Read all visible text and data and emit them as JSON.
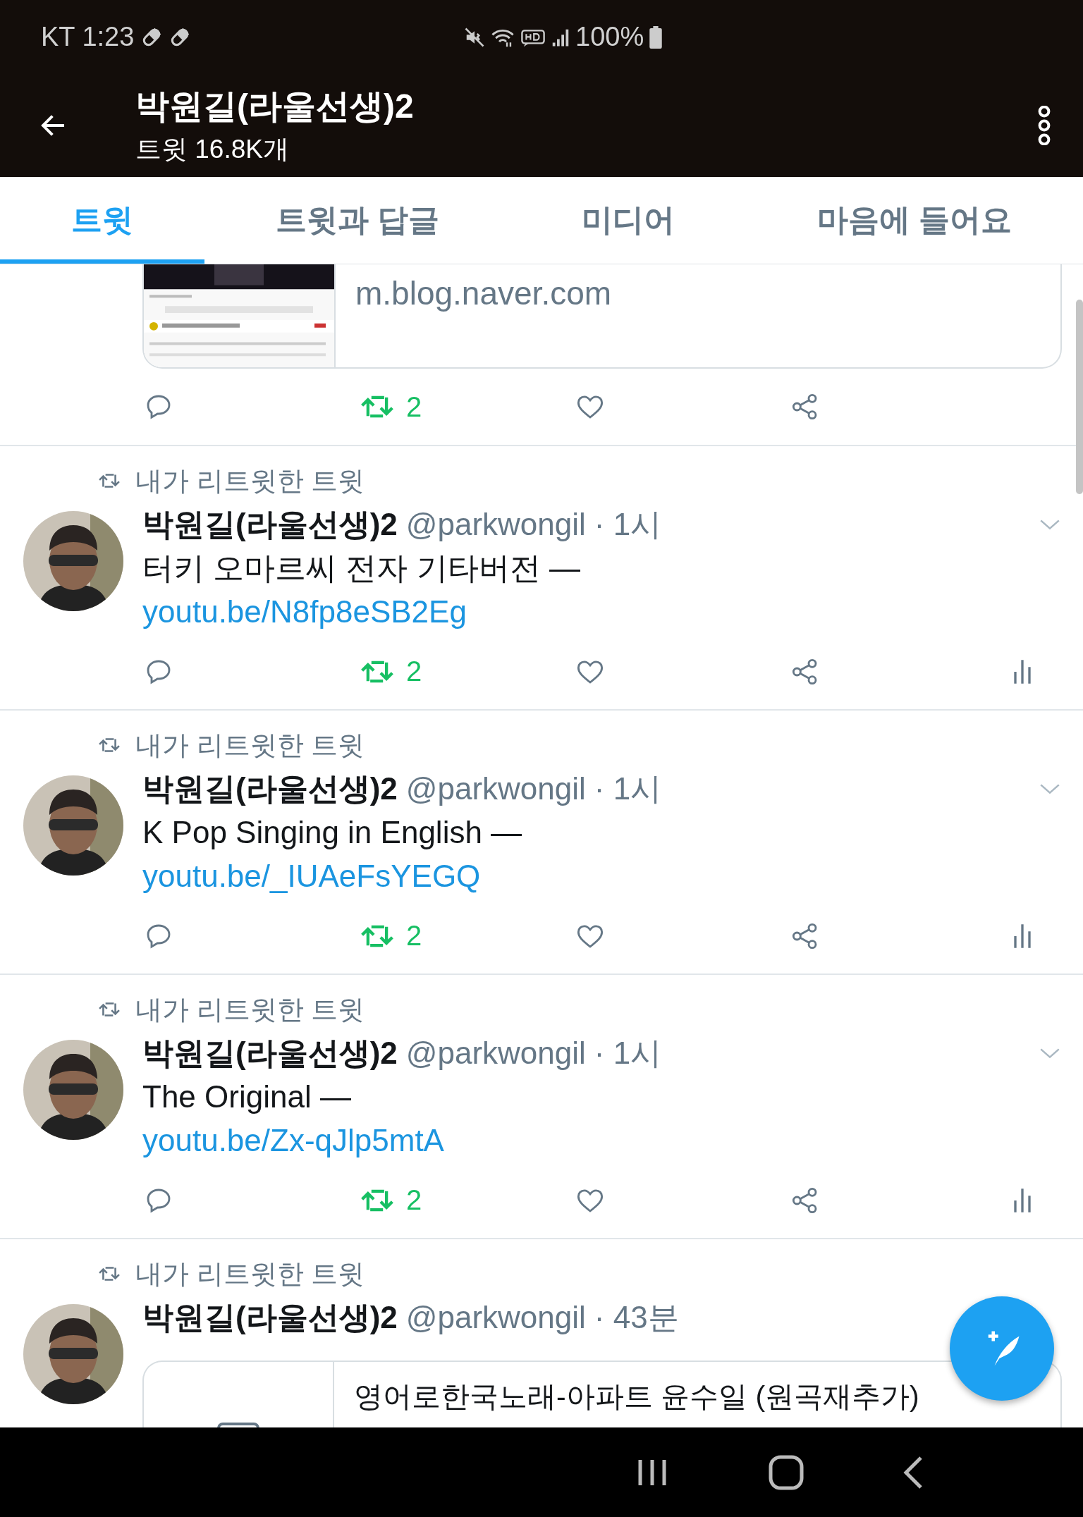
{
  "status_bar": {
    "carrier_time": "KT 1:23",
    "battery": "100%"
  },
  "header": {
    "title": "박원길(라울선생)2",
    "subtitle": "트윗 16.8K개"
  },
  "tabs": [
    {
      "label": "트윗",
      "selected": true
    },
    {
      "label": "트윗과 답글",
      "selected": false
    },
    {
      "label": "미디어",
      "selected": false
    },
    {
      "label": "마음에 들어요",
      "selected": false
    }
  ],
  "timeline": [
    {
      "kind": "partial",
      "card": {
        "domain": "m.blog.naver.com"
      },
      "retweet_count": "2",
      "retweeted": true,
      "analytics": false
    },
    {
      "kind": "tweet",
      "retweet_label": "내가 리트윗한 트윗",
      "name": "박원길(라울선생)2",
      "handle": "@parkwongil",
      "time": "· 1시",
      "text": "터키 오마르씨 전자 기타버전 —",
      "link": "youtu.be/N8fp8eSB2Eg",
      "retweet_count": "2",
      "retweeted": true,
      "analytics": true
    },
    {
      "kind": "tweet",
      "retweet_label": "내가 리트윗한 트윗",
      "name": "박원길(라울선생)2",
      "handle": "@parkwongil",
      "time": "· 1시",
      "text": "K Pop Singing in English —",
      "link": "youtu.be/_IUAeFsYEGQ",
      "retweet_count": "2",
      "retweeted": true,
      "analytics": true
    },
    {
      "kind": "tweet",
      "retweet_label": "내가 리트윗한 트윗",
      "name": "박원길(라울선생)2",
      "handle": "@parkwongil",
      "time": "· 1시",
      "text": "The Original —",
      "link": "youtu.be/Zx-qJlp5mtA",
      "retweet_count": "2",
      "retweeted": true,
      "analytics": true
    },
    {
      "kind": "tweet",
      "retweet_label": "내가 리트윗한 트윗",
      "name": "박원길(라울선생)2",
      "handle": "@parkwongil",
      "time": "· 43분",
      "card": {
        "title": "영어로한국노래-아파트 윤수일 (원곡재추가)"
      }
    }
  ]
}
